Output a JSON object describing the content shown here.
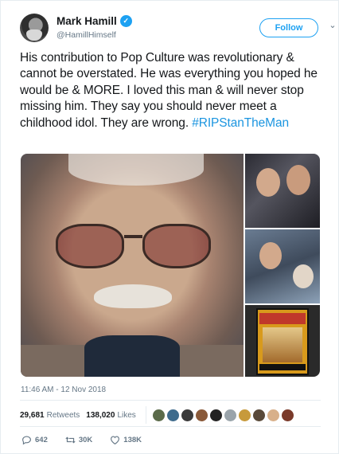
{
  "author": {
    "name": "Mark Hamill",
    "handle": "@HamillHimself",
    "verified_badge": "✓"
  },
  "follow_label": "Follow",
  "caret_icon": "⌄",
  "tweet": {
    "text": "His contribution to Pop Culture was revolutionary & cannot be overstated. He was everything you hoped he would be & MORE. I loved this man & will never stop missing him. They say you should never meet a childhood idol. They are wrong. ",
    "hashtag": "#RIPStanTheMan",
    "timestamp": "11:46 AM - 12 Nov 2018"
  },
  "stats": {
    "retweets": "29,681",
    "retweets_label": "Retweets",
    "likes": "138,020",
    "likes_label": "Likes",
    "liker_colors": [
      "#5b6b4a",
      "#3e6b8c",
      "#3a3a3a",
      "#8a5a3a",
      "#222222",
      "#9aa4ab",
      "#c79a3b",
      "#5a4a3a",
      "#d8b08a",
      "#7a3a2a"
    ]
  },
  "actions": {
    "replies": "642",
    "retweets": "30K",
    "likes": "138K"
  },
  "colors": {
    "accent": "#1da1f2",
    "hashtag": "#1b95e0",
    "muted": "#657786"
  }
}
